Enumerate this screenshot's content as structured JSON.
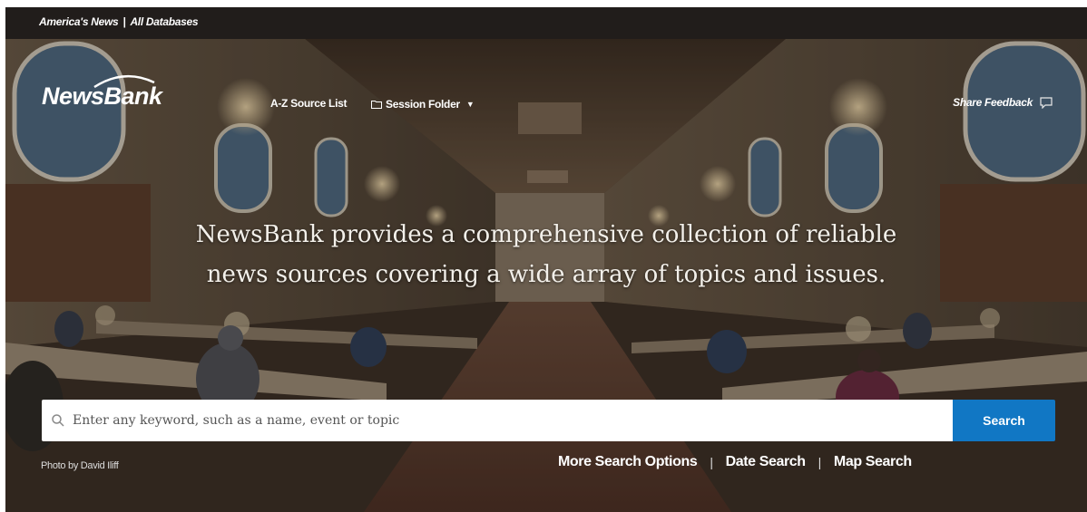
{
  "topbar": {
    "link1": "America's News",
    "separator": "|",
    "link2": "All Databases"
  },
  "header": {
    "logo_text": "NewsBank",
    "az_source_list": "A-Z Source List",
    "session_folder": "Session Folder",
    "share_feedback": "Share Feedback"
  },
  "hero": {
    "headline_line1": "NewsBank provides a comprehensive collection of reliable",
    "headline_line2": "news sources covering a wide array of topics and issues.",
    "photo_credit": "Photo by David Iliff"
  },
  "search": {
    "placeholder": "Enter any keyword, such as a name, event or topic",
    "button_label": "Search"
  },
  "search_links": {
    "more_options": "More Search Options",
    "date_search": "Date Search",
    "map_search": "Map Search",
    "separator": "|"
  },
  "colors": {
    "topbar_bg": "#211d1b",
    "search_button": "#1177c4"
  }
}
